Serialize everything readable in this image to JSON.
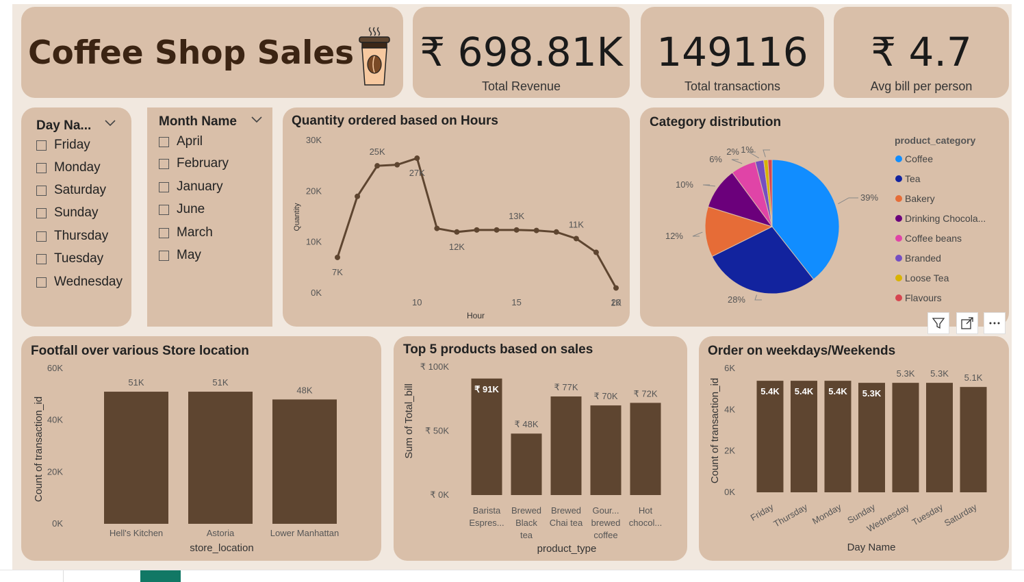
{
  "header": {
    "title": "Coffee Shop Sales",
    "icon": "coffee-cup-icon"
  },
  "kpis": [
    {
      "value": "₹ 698.81K",
      "label": "Total Revenue"
    },
    {
      "value": "149116",
      "label": "Total transactions"
    },
    {
      "value": "₹ 4.7",
      "label": "Avg bill per person"
    }
  ],
  "slicers": {
    "day": {
      "title": "Day Na...",
      "items": [
        "Friday",
        "Monday",
        "Saturday",
        "Sunday",
        "Thursday",
        "Tuesday",
        "Wednesday"
      ]
    },
    "month": {
      "title": "Month Name",
      "items": [
        "April",
        "February",
        "January",
        "June",
        "March",
        "May"
      ]
    }
  },
  "visual_toolbar": {
    "icons": [
      "filter-icon",
      "focus-mode-icon",
      "more-options-icon"
    ]
  },
  "colors": {
    "brown": "#5e4530",
    "card": "#d9bfa9",
    "canvas": "#f1e8df"
  },
  "chart_data": [
    {
      "type": "line",
      "title": "Quantity ordered based on Hours",
      "xlabel": "Hour",
      "ylabel": "Quantity",
      "x": [
        6,
        7,
        8,
        9,
        10,
        11,
        12,
        13,
        14,
        15,
        16,
        17,
        18,
        19,
        20
      ],
      "values": [
        7000,
        19000,
        25000,
        25200,
        26500,
        12700,
        12000,
        12400,
        12400,
        12400,
        12300,
        12000,
        10700,
        8000,
        1000
      ],
      "point_labels": {
        "0": "7K",
        "2": "25K",
        "4": "27K",
        "6": "12K",
        "9": "13K",
        "12": "11K",
        "14": "1K"
      },
      "xticks": [
        "10",
        "15",
        "20"
      ],
      "yticks": [
        "0K",
        "10K",
        "20K",
        "30K"
      ],
      "ylim": [
        0,
        30000
      ],
      "xlim": [
        6,
        20
      ]
    },
    {
      "type": "pie",
      "title": "Category distribution",
      "legend_title": "product_category",
      "labels": [
        "Coffee",
        "Tea",
        "Bakery",
        "Drinking Chocola...",
        "Coffee beans",
        "Branded",
        "Loose Tea",
        "Flavours"
      ],
      "values": [
        39,
        28,
        12,
        10,
        6,
        2,
        1,
        1
      ],
      "slice_labels": [
        "39%",
        "28%",
        "12%",
        "10%",
        "6%",
        "2%",
        "1%",
        ""
      ],
      "colors": [
        "#118dff",
        "#12239e",
        "#e66c37",
        "#6b007b",
        "#e044a7",
        "#744ec2",
        "#d9b300",
        "#d64550"
      ],
      "legend_position": "right"
    },
    {
      "type": "bar",
      "title": "Footfall over various Store location",
      "xlabel": "store_location",
      "ylabel": "Count of transaction_id",
      "categories": [
        "Hell's Kitchen",
        "Astoria",
        "Lower Manhattan"
      ],
      "values": [
        51000,
        51000,
        48000
      ],
      "data_labels": [
        "51K",
        "51K",
        "48K"
      ],
      "yticks": [
        "0K",
        "20K",
        "40K",
        "60K"
      ],
      "ylim": [
        0,
        60000
      ]
    },
    {
      "type": "bar",
      "title": "Top 5 products based on sales",
      "xlabel": "product_type",
      "ylabel": "Sum of Total_bill",
      "categories": [
        [
          "Barista",
          "Espres..."
        ],
        [
          "Brewed",
          "Black",
          "tea"
        ],
        [
          "Brewed",
          "Chai tea"
        ],
        [
          "Gour...",
          "brewed",
          "coffee"
        ],
        [
          "Hot",
          "chocol..."
        ]
      ],
      "values": [
        91000,
        48000,
        77000,
        70000,
        72000
      ],
      "data_labels": [
        "₹ 91K",
        "₹ 48K",
        "₹ 77K",
        "₹ 70K",
        "₹ 72K"
      ],
      "yticks": [
        "₹ 0K",
        "₹ 50K",
        "₹ 100K"
      ],
      "ylim": [
        0,
        100000
      ]
    },
    {
      "type": "bar",
      "title": "Order on weekdays/Weekends",
      "xlabel": "Day Name",
      "ylabel": "Count of transaction_id",
      "categories": [
        "Friday",
        "Thursday",
        "Monday",
        "Sunday",
        "Wednesday",
        "Tuesday",
        "Saturday"
      ],
      "values": [
        5400,
        5400,
        5400,
        5300,
        5300,
        5300,
        5100
      ],
      "data_labels": [
        "5.4K",
        "5.4K",
        "5.4K",
        "5.3K",
        "5.3K",
        "5.3K",
        "5.1K"
      ],
      "yticks": [
        "0K",
        "2K",
        "4K",
        "6K"
      ],
      "ylim": [
        0,
        6000
      ]
    }
  ]
}
